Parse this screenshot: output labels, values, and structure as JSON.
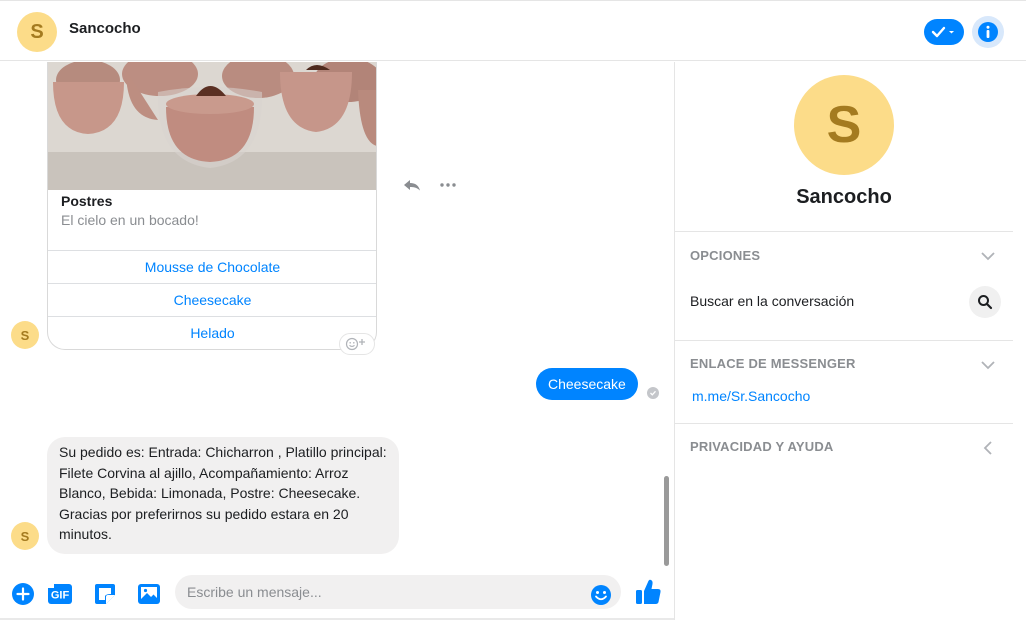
{
  "header": {
    "avatar_letter": "S",
    "title": "Sancocho"
  },
  "card": {
    "title": "Postres",
    "subtitle": "El cielo en un bocado!",
    "buttons": [
      "Mousse de Chocolate",
      "Cheesecake",
      "Helado"
    ]
  },
  "messages": {
    "outgoing": "Cheesecake",
    "incoming": "Su pedido es: Entrada: Chicharron , Platillo principal: Filete Corvina al ajillo, Acompañamiento: Arroz Blanco, Bebida: Limonada, Postre: Cheesecake. Gracias por preferirnos su pedido estara en 20 minutos."
  },
  "avatar_letter": "S",
  "composer": {
    "placeholder": "Escribe un mensaje...",
    "gif_label": "GIF"
  },
  "panel": {
    "avatar_letter": "S",
    "name": "Sancocho",
    "options_title": "OPCIONES",
    "search_label": "Buscar en la conversación",
    "link_title": "ENLACE DE MESSENGER",
    "link": "m.me/Sr.Sancocho",
    "privacy_title": "PRIVACIDAD Y AYUDA"
  },
  "colors": {
    "accent": "#0084ff",
    "avatar_bg": "#fcdc89",
    "bubble_in": "#f1f0f0"
  }
}
